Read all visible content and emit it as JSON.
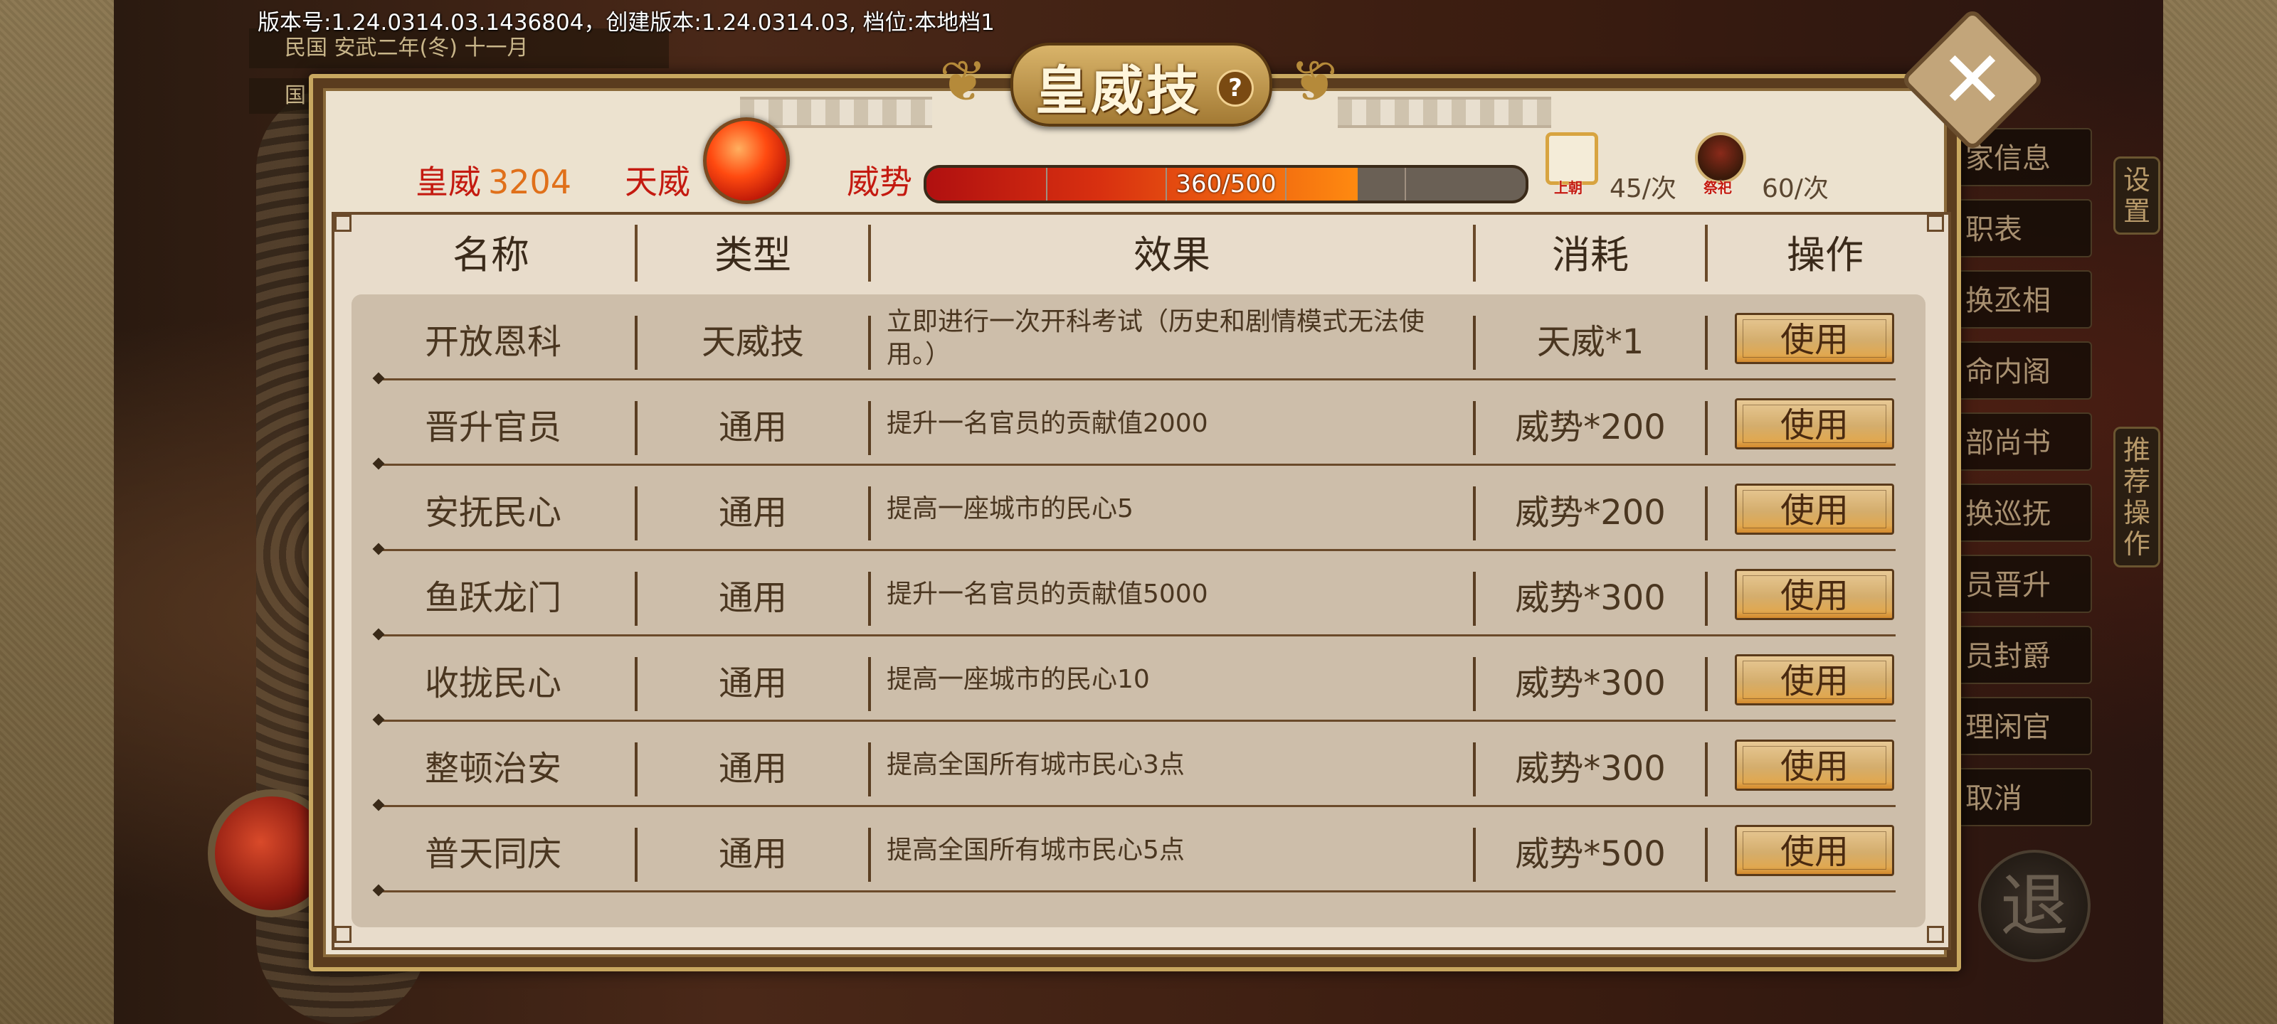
{
  "version_text": "版本号:1.24.0314.03.1436804，创建版本:1.24.0314.03, 档位:本地档1",
  "background": {
    "date_text": "民国 安武二年(冬) 十一月",
    "date_text2": "国",
    "menu_items": [
      "家信息",
      "职表",
      "换丞相",
      "命内阁",
      "部尚书",
      "换巡抚",
      "员晋升",
      "员封爵",
      "理闲官",
      "取消"
    ],
    "settings_tab": "设置",
    "recommend_tab": "推荐操作",
    "exit_label": "退"
  },
  "dialog": {
    "title": "皇威技",
    "help_label": "?",
    "close_label": "✕",
    "stats": {
      "huangwei_label": "皇威",
      "huangwei_value": "3204",
      "tianwei_label": "天威",
      "weishi_label": "威势",
      "weishi_text": "360/500",
      "weishi_fraction": 0.72,
      "shangchao_caption": "上朝",
      "shangchao_rate": "45/次",
      "jisi_caption": "祭祀",
      "jisi_rate": "60/次"
    },
    "columns": [
      "名称",
      "类型",
      "效果",
      "消耗",
      "操作"
    ],
    "rows": [
      {
        "name": "开放恩科",
        "type": "天威技",
        "effect": "立即进行一次开科考试（历史和剧情模式无法使用。）",
        "cost": "天威*1",
        "action": "使用"
      },
      {
        "name": "晋升官员",
        "type": "通用",
        "effect": "提升一名官员的贡献值2000",
        "cost": "威势*200",
        "action": "使用"
      },
      {
        "name": "安抚民心",
        "type": "通用",
        "effect": "提高一座城市的民心5",
        "cost": "威势*200",
        "action": "使用"
      },
      {
        "name": "鱼跃龙门",
        "type": "通用",
        "effect": "提升一名官员的贡献值5000",
        "cost": "威势*300",
        "action": "使用"
      },
      {
        "name": "收拢民心",
        "type": "通用",
        "effect": "提高一座城市的民心10",
        "cost": "威势*300",
        "action": "使用"
      },
      {
        "name": "整顿治安",
        "type": "通用",
        "effect": "提高全国所有城市民心3点",
        "cost": "威势*300",
        "action": "使用"
      },
      {
        "name": "普天同庆",
        "type": "通用",
        "effect": "提高全国所有城市民心5点",
        "cost": "威势*500",
        "action": "使用"
      }
    ]
  }
}
